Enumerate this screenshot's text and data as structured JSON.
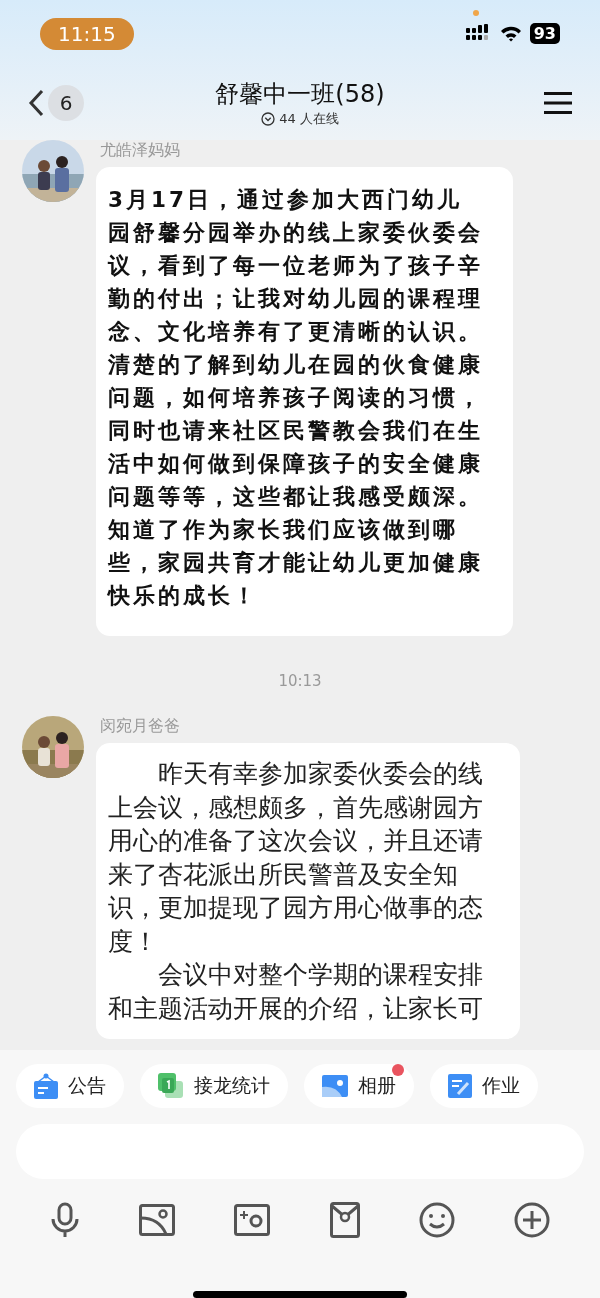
{
  "status_bar": {
    "time": "11:15",
    "battery": "93"
  },
  "header": {
    "back_count": "6",
    "title": "舒馨中一班(58)",
    "subtitle": "44 人在线"
  },
  "messages": [
    {
      "kind": "handwritten",
      "sender": "尤皓泽妈妈",
      "paragraphs": [
        "3月17日，通过参加大西门幼儿园舒馨分园举办的线上家委伙委会议，看到了每一位老师为了孩子辛勤的付出；让我对幼儿园的课程理念、文化培养有了更清晰的认识。清楚的了解到幼儿在园的伙食健康问题，如何培养孩子阅读的习惯，同时也请来社区民警教会我们在生活中如何做到保障孩子的安全健康问题等等，这些都让我感受颇深。知道了作为家长我们应该做到哪些，家园共育才能让幼儿更加健康快乐的成长！"
      ]
    },
    {
      "kind": "time",
      "text": "10:13"
    },
    {
      "kind": "plain",
      "sender": "闵宛月爸爸",
      "paragraphs": [
        "昨天有幸参加家委伙委会的线上会议，感想颇多，首先感谢园方用心的准备了这次会议，并且还请来了杏花派出所民警普及安全知识，更加提现了园方用心做事的态度！",
        "会议中对整个学期的课程安排和主题活动开展的介绍，让家长可"
      ]
    }
  ],
  "quick_actions": [
    {
      "kind": "notice",
      "label": "公告",
      "badge": false
    },
    {
      "kind": "relay",
      "label": "接龙统计",
      "badge": false
    },
    {
      "kind": "album",
      "label": "相册",
      "badge": true
    },
    {
      "kind": "homework",
      "label": "作业",
      "badge": false
    }
  ]
}
